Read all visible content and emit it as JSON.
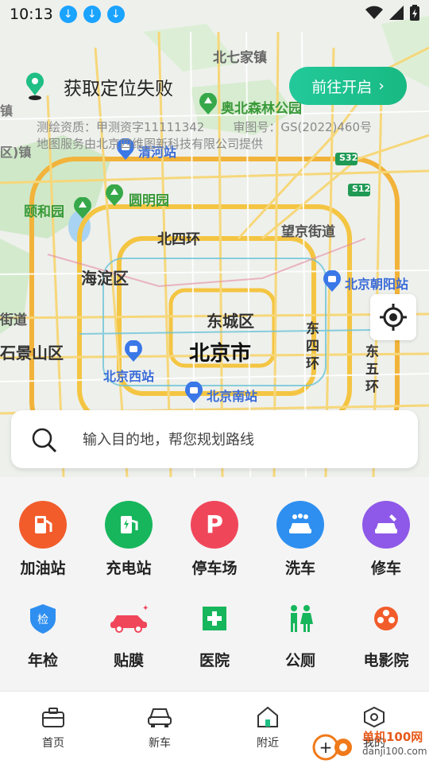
{
  "status": {
    "time": "10:13"
  },
  "location": {
    "message": "获取定位失败",
    "enable_button": "前往开启"
  },
  "map": {
    "credit_survey": "测绘资质：甲测资字11111342",
    "credit_review": "审图号：GS(2022)460号",
    "credit_service": "地图服务由北京四维图新科技有限公司提供",
    "labels": {
      "city": "北京市",
      "dongcheng": "东城区",
      "haidian": "海淀区",
      "shijingshan": "石景山区",
      "beisihuan": "北四环",
      "dongsihuan": "东四环",
      "dongwuhuan": "东五环",
      "wangjing": "望京街道",
      "beiqijia": "北七家镇",
      "yiheyuan": "颐和园",
      "yuanmingyuan": "圆明园",
      "aobei": "奥北森林公园",
      "qinghe": "清河站",
      "chaoyang": "北京朝阳站",
      "beijingxi": "北京西站",
      "beijingnan": "北京南站",
      "s32": "S32",
      "s12": "S12",
      "jiedao": "街道",
      "left_town": "区)镇",
      "town": "镇"
    }
  },
  "search": {
    "placeholder": "输入目的地，帮您规划路线"
  },
  "categories": [
    {
      "label": "加油站",
      "icon": "fuel-pump-icon",
      "color": "#f25c2b"
    },
    {
      "label": "充电站",
      "icon": "charging-station-icon",
      "color": "#17b65c"
    },
    {
      "label": "停车场",
      "icon": "parking-icon",
      "color": "#f0465a"
    },
    {
      "label": "洗车",
      "icon": "car-wash-icon",
      "color": "#2e8ff0"
    },
    {
      "label": "修车",
      "icon": "car-repair-icon",
      "color": "#8e58e8"
    },
    {
      "label": "年检",
      "icon": "inspection-shield-icon",
      "color": "#2e8ff0"
    },
    {
      "label": "贴膜",
      "icon": "car-film-icon",
      "color": "#f0465a"
    },
    {
      "label": "医院",
      "icon": "hospital-icon",
      "color": "#17b65c"
    },
    {
      "label": "公厕",
      "icon": "restroom-icon",
      "color": "#17b65c"
    },
    {
      "label": "电影院",
      "icon": "film-reel-icon",
      "color": "#f25c2b"
    }
  ],
  "tabs": [
    {
      "label": "首页",
      "icon": "briefcase-icon"
    },
    {
      "label": "新车",
      "icon": "car-icon"
    },
    {
      "label": "附近",
      "icon": "home-icon"
    },
    {
      "label": "我的",
      "icon": "hexagon-icon"
    }
  ],
  "watermark": {
    "site": "单机100网",
    "domain": "danji100.com"
  }
}
